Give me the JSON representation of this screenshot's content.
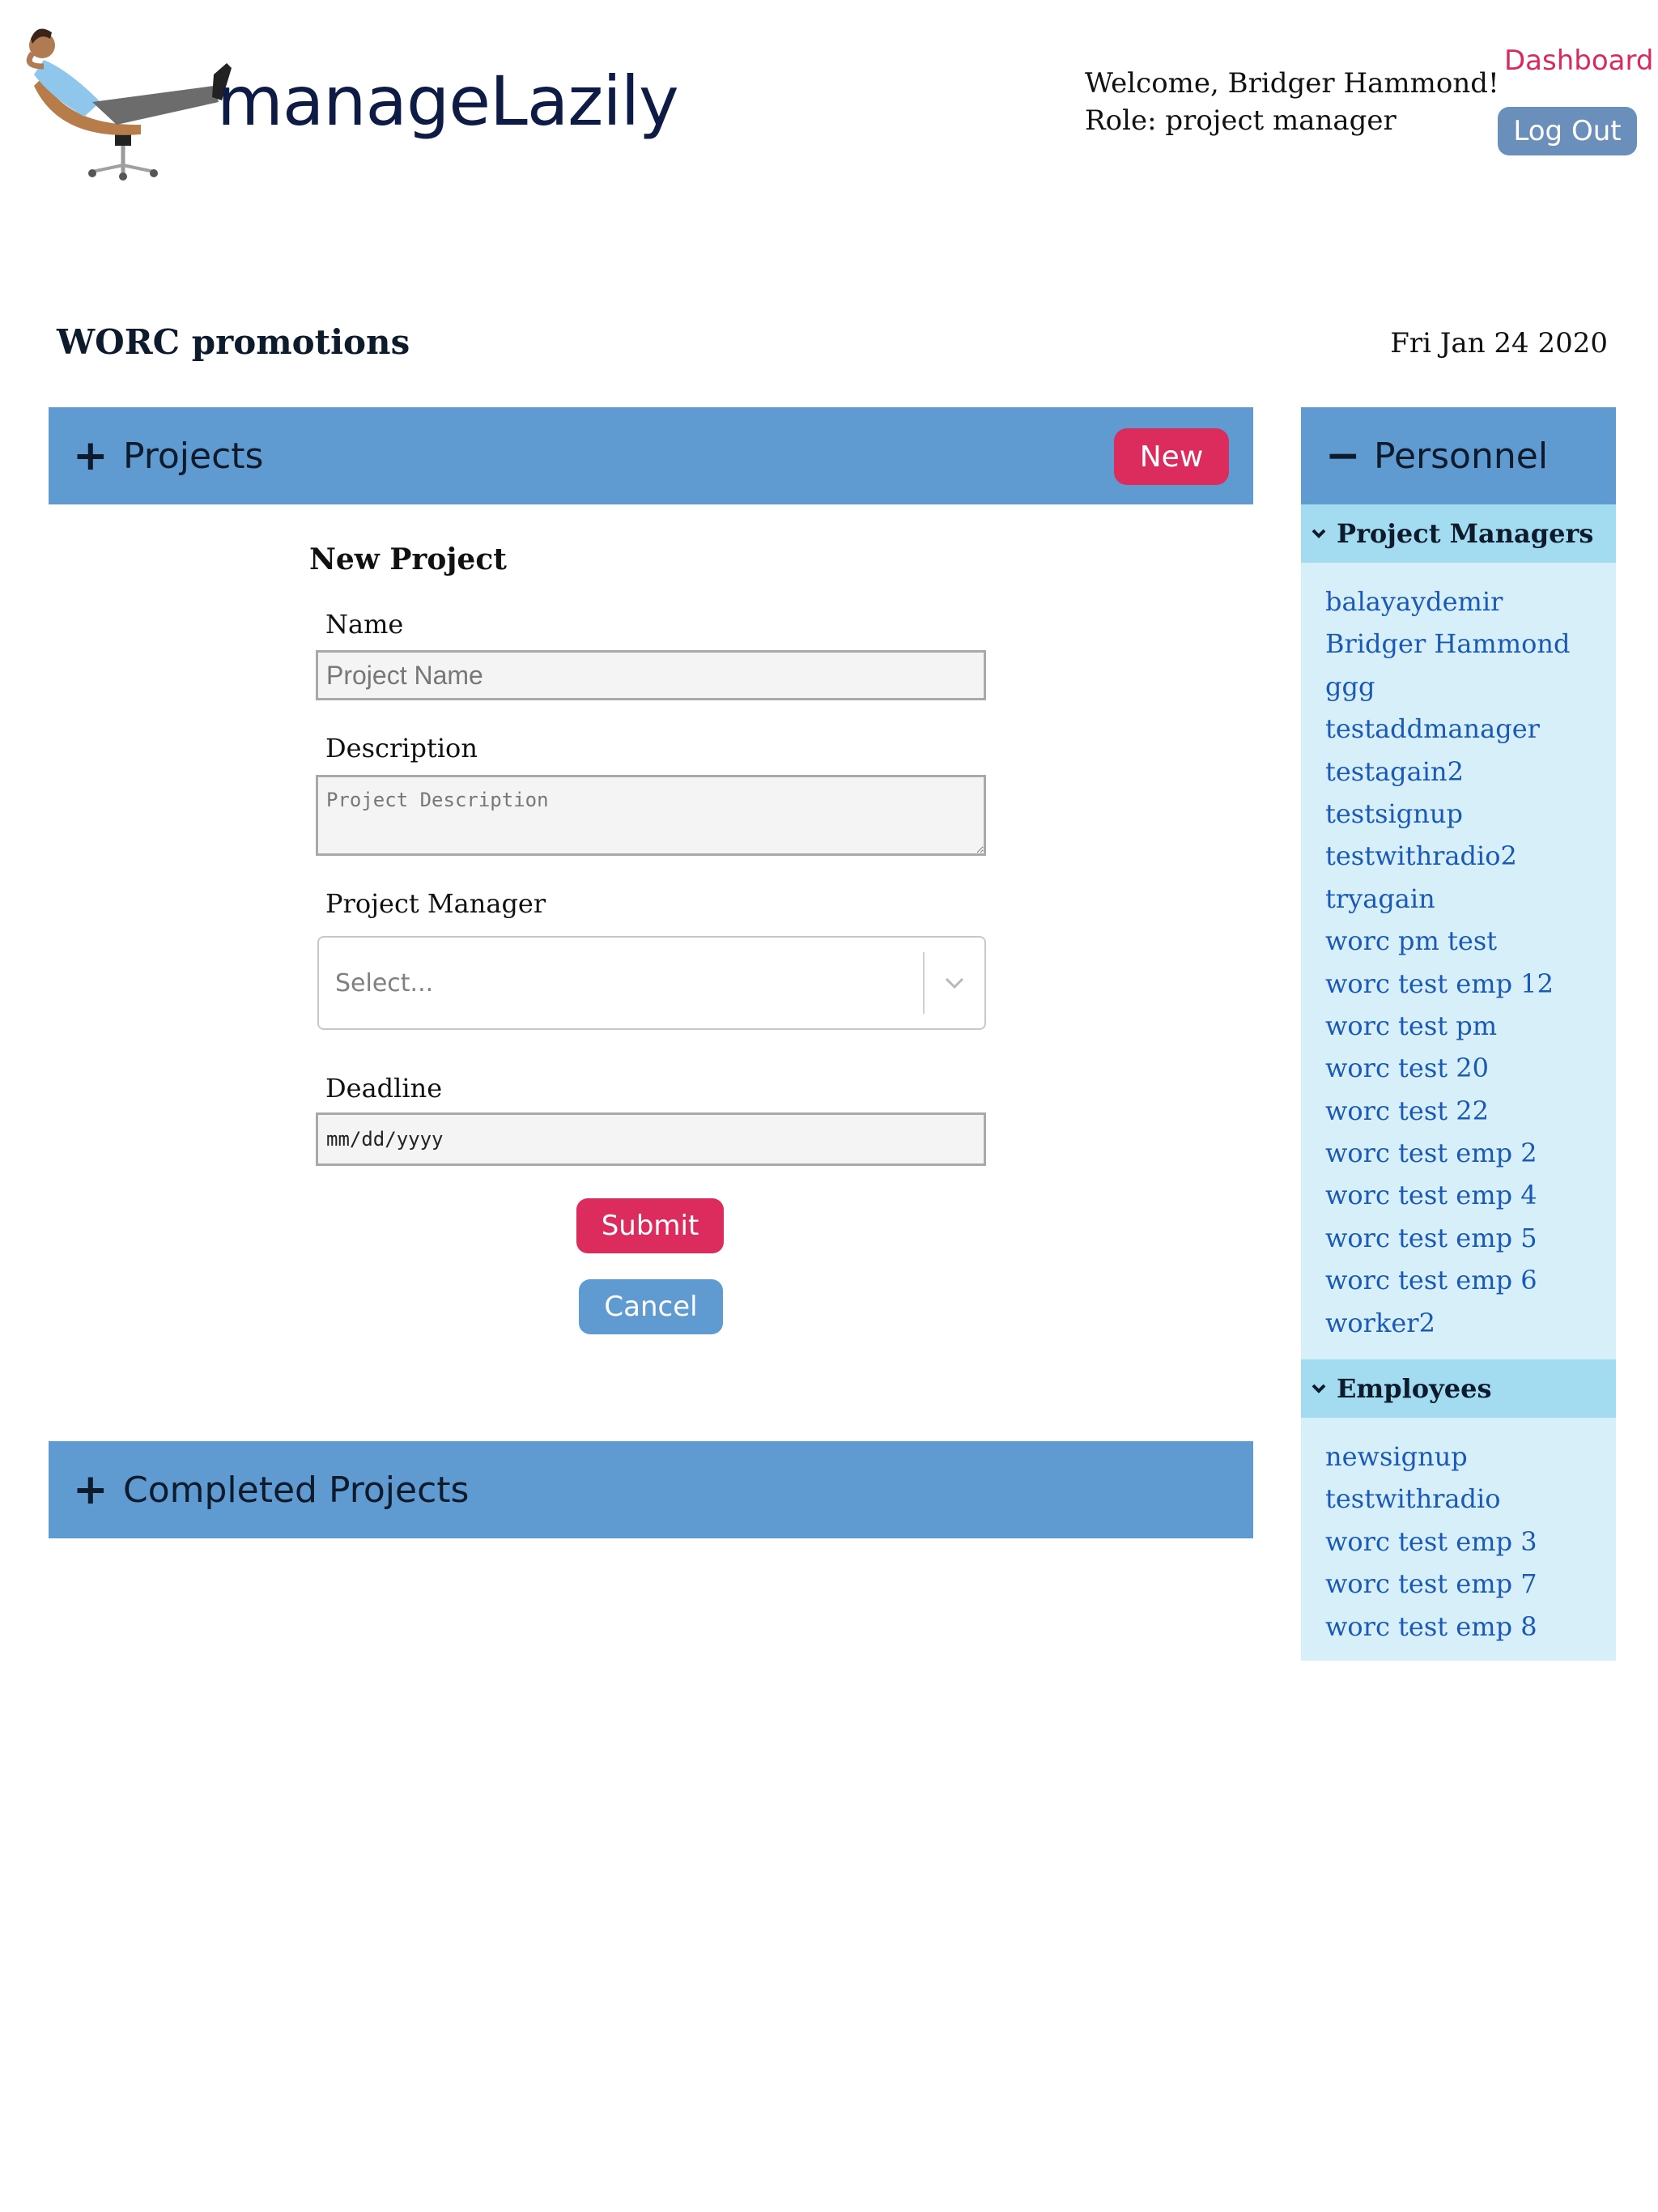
{
  "header": {
    "app_name": "manageLazily",
    "welcome": "Welcome, Bridger Hammond!",
    "role": "Role: project manager",
    "dashboard_link": "Dashboard",
    "logout_label": "Log Out"
  },
  "org": {
    "name": "WORC promotions",
    "date": "Fri Jan 24 2020"
  },
  "projects_panel": {
    "toggle": "+",
    "title": "Projects",
    "new_label": "New"
  },
  "form": {
    "title": "New Project",
    "name_label": "Name",
    "name_placeholder": "Project Name",
    "description_label": "Description",
    "description_placeholder": "Project Description",
    "manager_label": "Project Manager",
    "manager_placeholder": "Select...",
    "deadline_label": "Deadline",
    "deadline_placeholder": "mm/dd/yyyy",
    "submit_label": "Submit",
    "cancel_label": "Cancel"
  },
  "completed_panel": {
    "toggle": "+",
    "title": "Completed Projects"
  },
  "personnel": {
    "toggle": "−",
    "title": "Personnel",
    "managers_title": "Project Managers",
    "managers": [
      "balayaydemir",
      "Bridger Hammond",
      "ggg",
      "testaddmanager",
      "testagain2",
      "testsignup",
      "testwithradio2",
      "tryagain",
      "worc pm test",
      "worc test emp 12",
      "worc test pm",
      "worc test 20",
      "worc test 22",
      "worc test emp 2",
      "worc test emp 4",
      "worc test emp 5",
      "worc test emp 6",
      "worker2"
    ],
    "employees_title": "Employees",
    "employees": [
      "newsignup",
      "testwithradio",
      "worc test emp 3",
      "worc test emp 7",
      "worc test emp 8"
    ]
  },
  "colors": {
    "accent_pink": "#dc2c5e",
    "panel_blue": "#5f9bd1",
    "personnel_bg": "#d6eff9",
    "group_header_bg": "#a3dbf0",
    "link_blue": "#1a59b5"
  }
}
